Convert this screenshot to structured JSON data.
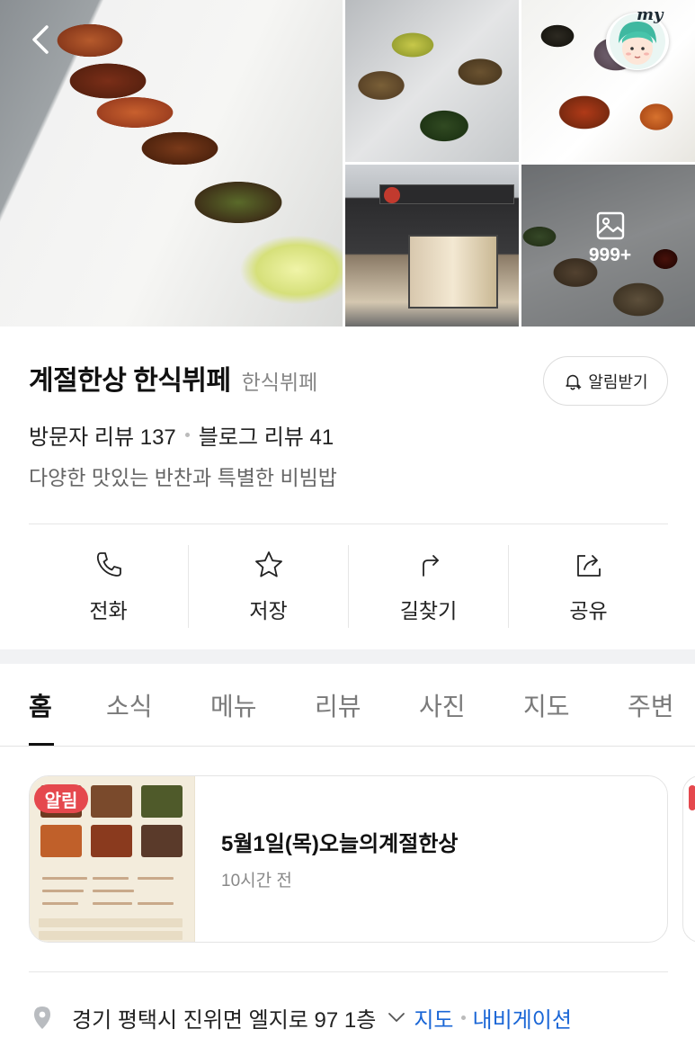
{
  "photos": {
    "count_label": "999+",
    "avatar_badge": "my"
  },
  "place": {
    "name": "계절한상 한식뷔페",
    "category": "한식뷔페",
    "notify_label": "알림받기",
    "visitor_review": "방문자 리뷰 137",
    "blog_review": "블로그 리뷰 41",
    "description": "다양한 맛있는 반찬과 특별한 비빔밥"
  },
  "actions": [
    {
      "label": "전화",
      "icon": "phone-icon"
    },
    {
      "label": "저장",
      "icon": "star-icon"
    },
    {
      "label": "길찾기",
      "icon": "directions-icon"
    },
    {
      "label": "공유",
      "icon": "share-icon"
    }
  ],
  "tabs": [
    {
      "label": "홈",
      "active": true
    },
    {
      "label": "소식",
      "active": false
    },
    {
      "label": "메뉴",
      "active": false
    },
    {
      "label": "리뷰",
      "active": false
    },
    {
      "label": "사진",
      "active": false
    },
    {
      "label": "지도",
      "active": false
    },
    {
      "label": "주변",
      "active": false
    }
  ],
  "notice": {
    "badge": "알림",
    "title": "5월1일(목)오늘의계절한상",
    "time": "10시간 전"
  },
  "address": {
    "text": "경기 평택시 진위면 엘지로 97 1층",
    "map_link": "지도",
    "navigation_link": "내비게이션"
  },
  "colors": {
    "link_blue": "#1a66d6",
    "alert_red": "#e5484d",
    "tab_active": "#111111",
    "tab_inactive": "#7a7a7a"
  }
}
